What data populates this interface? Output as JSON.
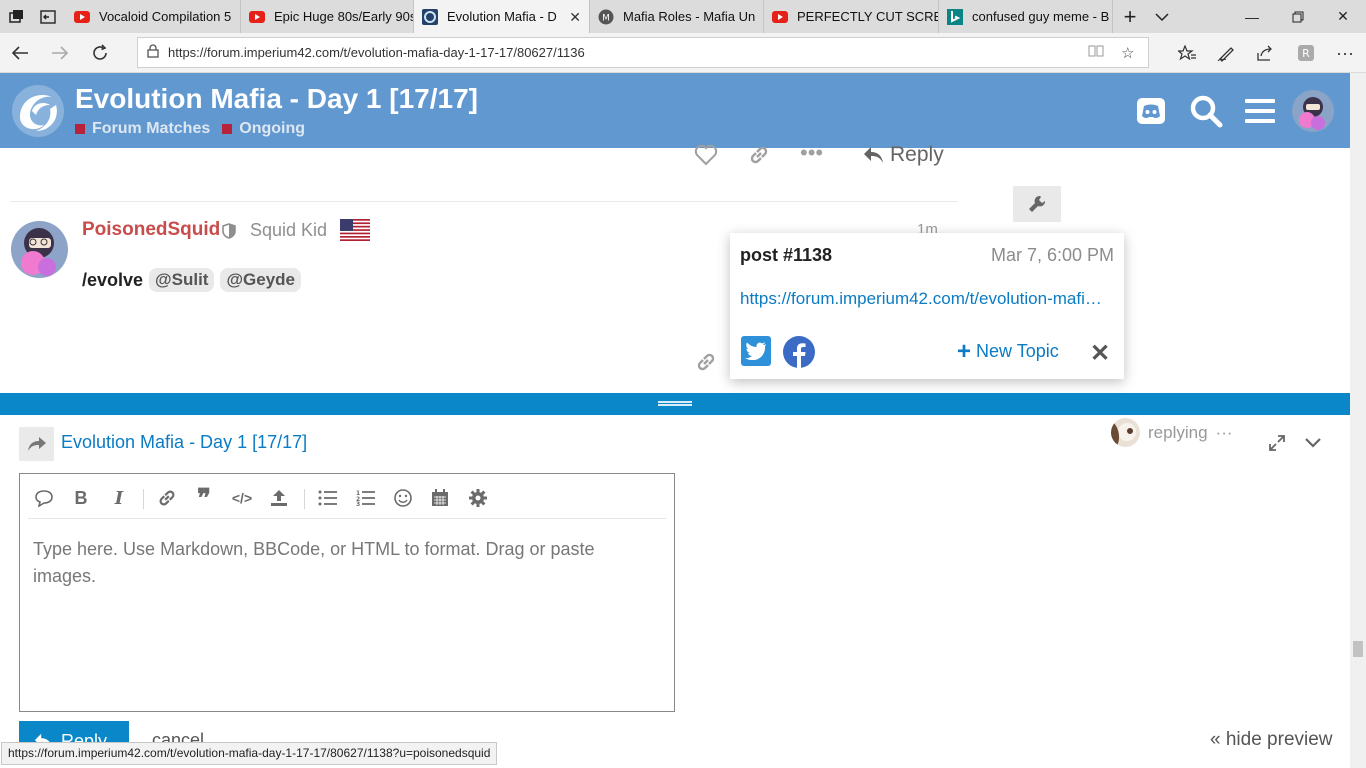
{
  "browser": {
    "tabs": [
      {
        "title": "Vocaloid Compilation 5",
        "favicon": "youtube-icon"
      },
      {
        "title": "Epic Huge 80s/Early 90s",
        "favicon": "youtube-icon"
      },
      {
        "title": "Evolution Mafia - D",
        "favicon": "imperium-icon",
        "active": true
      },
      {
        "title": "Mafia Roles - Mafia Un",
        "favicon": "mafia-universe-icon"
      },
      {
        "title": "PERFECTLY CUT SCREA",
        "favicon": "youtube-icon"
      },
      {
        "title": "confused guy meme - B",
        "favicon": "bing-icon"
      }
    ],
    "url": "https://forum.imperium42.com/t/evolution-mafia-day-1-17-17/80627/1136",
    "status_url": "https://forum.imperium42.com/t/evolution-mafia-day-1-17-17/80627/1138?u=poisonedsquid"
  },
  "header": {
    "title": "Evolution Mafia - Day 1 [17/17]",
    "categories": [
      "Forum Matches",
      "Ongoing"
    ],
    "category_color": "#b7233b",
    "bg_color": "#6198d0"
  },
  "post_prev": {
    "reply_label": "Reply"
  },
  "post": {
    "username": "PoisonedSquid",
    "user_title": "Squid Kid",
    "time": "1m",
    "body_text": "/evolve",
    "mentions": [
      "@Sulit",
      "@Geyde"
    ]
  },
  "share": {
    "title": "post #1138",
    "date": "Mar 7, 6:00 PM",
    "url": "https://forum.imperium42.com/t/evolution-mafia-day-1-17-17/80627/1138?u=poisonedsquid",
    "new_topic_label": "New Topic"
  },
  "composer": {
    "topic_title": "Evolution Mafia - Day 1 [17/17]",
    "replying_label": "replying",
    "placeholder": "Type here. Use Markdown, BBCode, or HTML to format. Drag or paste images.",
    "reply_button": "Reply",
    "cancel_label": "cancel",
    "hide_preview_label": "« hide preview",
    "accent_color": "#0a87c9"
  }
}
